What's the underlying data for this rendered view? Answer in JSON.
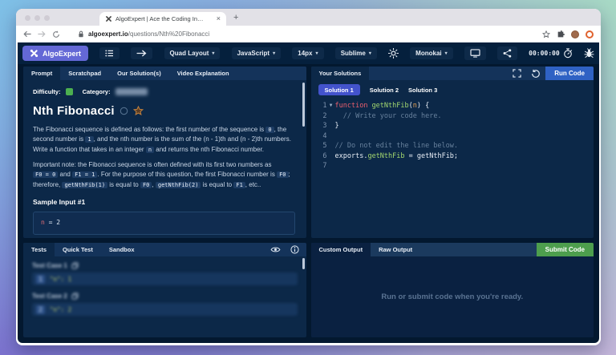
{
  "browser": {
    "tab_title": "AlgoExpert | Ace the Coding In…",
    "new_tab": "+",
    "close_tab": "×",
    "url": "algoexpert.io/questions/Nth%20Fibonacci",
    "url_domain": "algoexpert.io",
    "url_path": "/questions/Nth%20Fibonacci"
  },
  "toolbar": {
    "brand": "AlgoExpert",
    "layout_dropdown": "Quad Layout",
    "language_dropdown": "JavaScript",
    "fontsize_dropdown": "14px",
    "keybinding_dropdown": "Sublime",
    "theme_dropdown": "Monokai",
    "timer": "00:00:00",
    "caret": "▾"
  },
  "icons": {
    "brand-logo": "knot-x",
    "list-icon": "list",
    "arrow-right-icon": "arrow",
    "sun-icon": "sun",
    "monitor-icon": "monitor",
    "share-icon": "share",
    "stopwatch-icon": "stopwatch",
    "bug-icon": "bug",
    "fullscreen-icon": "corners",
    "reset-icon": "undo-arrow",
    "eye-icon": "eye",
    "info-icon": "i-circle",
    "copy-icon": "copy",
    "lock-icon": "padlock",
    "star-icon": "star",
    "circle-icon": "circle",
    "bookmark-star-icon": "star",
    "extensions-icon": "puzzle"
  },
  "prompt": {
    "tabs": [
      "Prompt",
      "Scratchpad",
      "Our Solution(s)",
      "Video Explanation"
    ],
    "difficulty_label": "Difficulty:",
    "category_label": "Category:",
    "title": "Nth Fibonacci",
    "paragraphs": [
      [
        {
          "t": "The Fibonacci sequence is defined as follows: the first number of the sequence is "
        },
        {
          "c": "0"
        },
        {
          "t": ", the second number is "
        },
        {
          "c": "1"
        },
        {
          "t": ", and the nth number is the sum of the (n - 1)th and (n - 2)th numbers. Write a function that takes in an integer "
        },
        {
          "c": "n"
        },
        {
          "t": " and returns the nth Fibonacci number."
        }
      ],
      [
        {
          "t": "Important note: the Fibonacci sequence is often defined with its first two numbers as "
        },
        {
          "c": "F0 = 0"
        },
        {
          "t": " and "
        },
        {
          "c": "F1 = 1"
        },
        {
          "t": ". For the purpose of this question, the first Fibonacci number is "
        },
        {
          "c": "F0"
        },
        {
          "t": "; therefore, "
        },
        {
          "c": "getNthFib(1)"
        },
        {
          "t": " is equal to "
        },
        {
          "c": "F0"
        },
        {
          "t": ", "
        },
        {
          "c": "getNthFib(2)"
        },
        {
          "t": " is equal to "
        },
        {
          "c": "F1"
        },
        {
          "t": ", etc.."
        }
      ]
    ],
    "sample_heading": "Sample Input #1",
    "sample_var": "n",
    "sample_rest": " = 2"
  },
  "solutions": {
    "panel_tab": "Your Solutions",
    "tabs": [
      "Solution 1",
      "Solution 2",
      "Solution 3"
    ],
    "run_button": "Run Code"
  },
  "editor": {
    "lines": [
      {
        "fold": true,
        "seg": [
          {
            "s": "function ",
            "c": "kw"
          },
          {
            "s": "getNthFib",
            "c": "fn"
          },
          {
            "s": "(",
            "c": "pl"
          },
          {
            "s": "n",
            "c": "pr"
          },
          {
            "s": ") {",
            "c": "pl"
          }
        ]
      },
      {
        "seg": [
          {
            "s": "  // Write your code here.",
            "c": "cm"
          }
        ]
      },
      {
        "seg": [
          {
            "s": "}",
            "c": "pl"
          }
        ]
      },
      {
        "seg": []
      },
      {
        "seg": [
          {
            "s": "// Do not edit the line below.",
            "c": "cm"
          }
        ]
      },
      {
        "seg": [
          {
            "s": "exports.",
            "c": "pl"
          },
          {
            "s": "getNthFib",
            "c": "fn"
          },
          {
            "s": " = getNthFib;",
            "c": "pl"
          }
        ]
      },
      {
        "seg": []
      }
    ]
  },
  "tests": {
    "tabs": [
      "Tests",
      "Quick Test",
      "Sandbox"
    ],
    "cases": [
      {
        "label": "Test Case 1",
        "chip": "1",
        "value": "\"n\": 1"
      },
      {
        "label": "Test Case 2",
        "chip": "2",
        "value": "\"n\": 2"
      }
    ],
    "blurred": true
  },
  "output": {
    "tabs": [
      "Custom Output",
      "Raw Output"
    ],
    "submit_button": "Submit Code",
    "message": "Run or submit code when you're ready."
  }
}
